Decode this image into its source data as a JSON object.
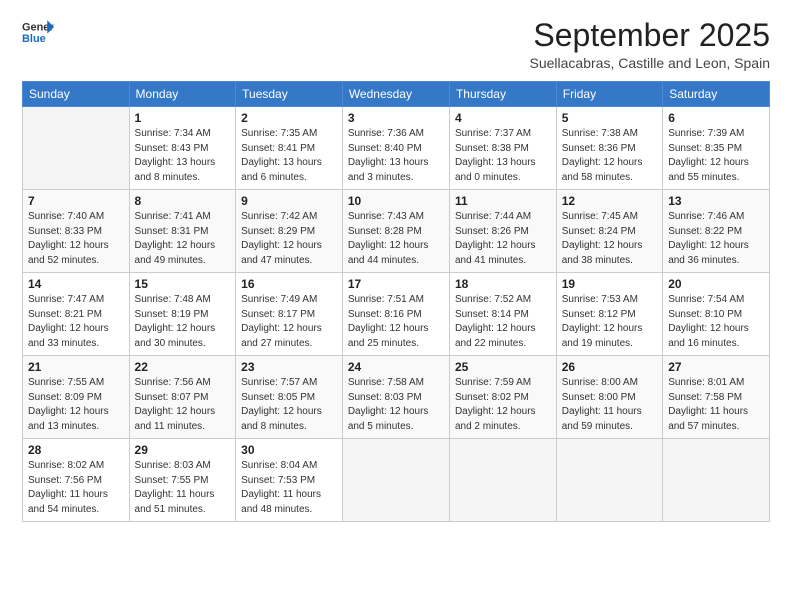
{
  "logo": {
    "line1": "General",
    "line2": "Blue"
  },
  "header": {
    "month": "September 2025",
    "location": "Suellacabras, Castille and Leon, Spain"
  },
  "weekdays": [
    "Sunday",
    "Monday",
    "Tuesday",
    "Wednesday",
    "Thursday",
    "Friday",
    "Saturday"
  ],
  "weeks": [
    [
      {
        "day": "",
        "info": ""
      },
      {
        "day": "1",
        "info": "Sunrise: 7:34 AM\nSunset: 8:43 PM\nDaylight: 13 hours\nand 8 minutes."
      },
      {
        "day": "2",
        "info": "Sunrise: 7:35 AM\nSunset: 8:41 PM\nDaylight: 13 hours\nand 6 minutes."
      },
      {
        "day": "3",
        "info": "Sunrise: 7:36 AM\nSunset: 8:40 PM\nDaylight: 13 hours\nand 3 minutes."
      },
      {
        "day": "4",
        "info": "Sunrise: 7:37 AM\nSunset: 8:38 PM\nDaylight: 13 hours\nand 0 minutes."
      },
      {
        "day": "5",
        "info": "Sunrise: 7:38 AM\nSunset: 8:36 PM\nDaylight: 12 hours\nand 58 minutes."
      },
      {
        "day": "6",
        "info": "Sunrise: 7:39 AM\nSunset: 8:35 PM\nDaylight: 12 hours\nand 55 minutes."
      }
    ],
    [
      {
        "day": "7",
        "info": "Sunrise: 7:40 AM\nSunset: 8:33 PM\nDaylight: 12 hours\nand 52 minutes."
      },
      {
        "day": "8",
        "info": "Sunrise: 7:41 AM\nSunset: 8:31 PM\nDaylight: 12 hours\nand 49 minutes."
      },
      {
        "day": "9",
        "info": "Sunrise: 7:42 AM\nSunset: 8:29 PM\nDaylight: 12 hours\nand 47 minutes."
      },
      {
        "day": "10",
        "info": "Sunrise: 7:43 AM\nSunset: 8:28 PM\nDaylight: 12 hours\nand 44 minutes."
      },
      {
        "day": "11",
        "info": "Sunrise: 7:44 AM\nSunset: 8:26 PM\nDaylight: 12 hours\nand 41 minutes."
      },
      {
        "day": "12",
        "info": "Sunrise: 7:45 AM\nSunset: 8:24 PM\nDaylight: 12 hours\nand 38 minutes."
      },
      {
        "day": "13",
        "info": "Sunrise: 7:46 AM\nSunset: 8:22 PM\nDaylight: 12 hours\nand 36 minutes."
      }
    ],
    [
      {
        "day": "14",
        "info": "Sunrise: 7:47 AM\nSunset: 8:21 PM\nDaylight: 12 hours\nand 33 minutes."
      },
      {
        "day": "15",
        "info": "Sunrise: 7:48 AM\nSunset: 8:19 PM\nDaylight: 12 hours\nand 30 minutes."
      },
      {
        "day": "16",
        "info": "Sunrise: 7:49 AM\nSunset: 8:17 PM\nDaylight: 12 hours\nand 27 minutes."
      },
      {
        "day": "17",
        "info": "Sunrise: 7:51 AM\nSunset: 8:16 PM\nDaylight: 12 hours\nand 25 minutes."
      },
      {
        "day": "18",
        "info": "Sunrise: 7:52 AM\nSunset: 8:14 PM\nDaylight: 12 hours\nand 22 minutes."
      },
      {
        "day": "19",
        "info": "Sunrise: 7:53 AM\nSunset: 8:12 PM\nDaylight: 12 hours\nand 19 minutes."
      },
      {
        "day": "20",
        "info": "Sunrise: 7:54 AM\nSunset: 8:10 PM\nDaylight: 12 hours\nand 16 minutes."
      }
    ],
    [
      {
        "day": "21",
        "info": "Sunrise: 7:55 AM\nSunset: 8:09 PM\nDaylight: 12 hours\nand 13 minutes."
      },
      {
        "day": "22",
        "info": "Sunrise: 7:56 AM\nSunset: 8:07 PM\nDaylight: 12 hours\nand 11 minutes."
      },
      {
        "day": "23",
        "info": "Sunrise: 7:57 AM\nSunset: 8:05 PM\nDaylight: 12 hours\nand 8 minutes."
      },
      {
        "day": "24",
        "info": "Sunrise: 7:58 AM\nSunset: 8:03 PM\nDaylight: 12 hours\nand 5 minutes."
      },
      {
        "day": "25",
        "info": "Sunrise: 7:59 AM\nSunset: 8:02 PM\nDaylight: 12 hours\nand 2 minutes."
      },
      {
        "day": "26",
        "info": "Sunrise: 8:00 AM\nSunset: 8:00 PM\nDaylight: 11 hours\nand 59 minutes."
      },
      {
        "day": "27",
        "info": "Sunrise: 8:01 AM\nSunset: 7:58 PM\nDaylight: 11 hours\nand 57 minutes."
      }
    ],
    [
      {
        "day": "28",
        "info": "Sunrise: 8:02 AM\nSunset: 7:56 PM\nDaylight: 11 hours\nand 54 minutes."
      },
      {
        "day": "29",
        "info": "Sunrise: 8:03 AM\nSunset: 7:55 PM\nDaylight: 11 hours\nand 51 minutes."
      },
      {
        "day": "30",
        "info": "Sunrise: 8:04 AM\nSunset: 7:53 PM\nDaylight: 11 hours\nand 48 minutes."
      },
      {
        "day": "",
        "info": ""
      },
      {
        "day": "",
        "info": ""
      },
      {
        "day": "",
        "info": ""
      },
      {
        "day": "",
        "info": ""
      }
    ]
  ]
}
